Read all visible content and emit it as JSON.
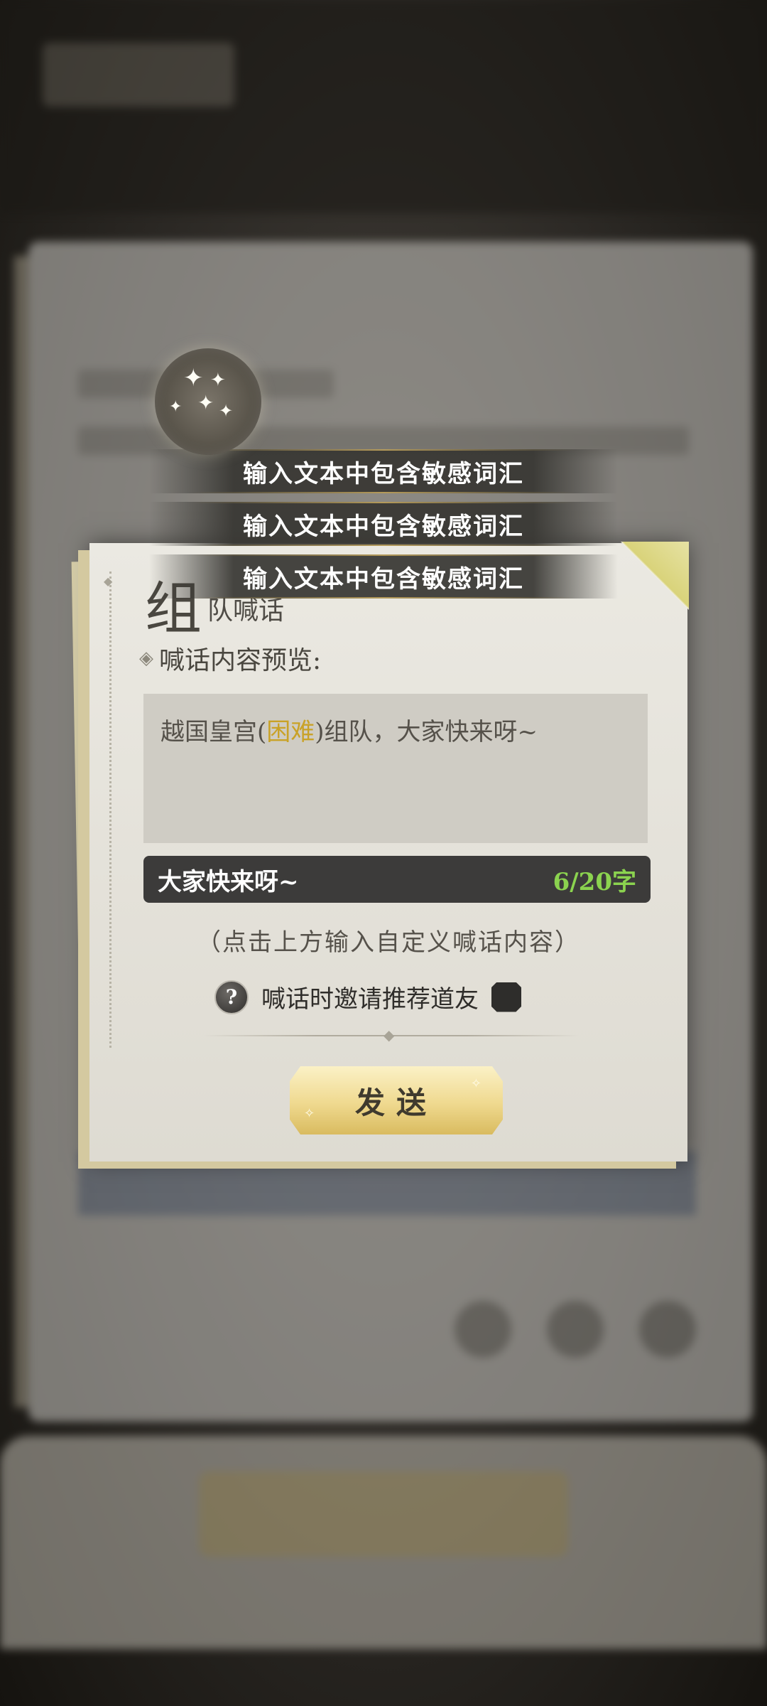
{
  "toasts": [
    "输入文本中包含敏感词汇",
    "输入文本中包含敏感词汇",
    "输入文本中包含敏感词汇"
  ],
  "dialog": {
    "title_big": "组",
    "title_small": "队喊话",
    "preview_label": "喊话内容预览:",
    "preview_parts": {
      "before": "越国皇宫(",
      "highlight": "困难",
      "after": ")组队，大家快来呀~"
    },
    "input_value": "大家快来呀~",
    "char_count": "6/20字",
    "hint": "（点击上方输入自定义喊话内容）",
    "invite_label": "喊话时邀请推荐道友",
    "invite_checked": false,
    "send_label": "发送"
  },
  "colors": {
    "highlight": "#c9a227",
    "char_count": "#8bd34f",
    "send_button": "#efd98f",
    "input_bar": "#3c3b3a"
  },
  "icons": {
    "help": "question-mark-icon",
    "orb": "sparkle-orb-icon",
    "section": "diamond-bullet-icon"
  }
}
